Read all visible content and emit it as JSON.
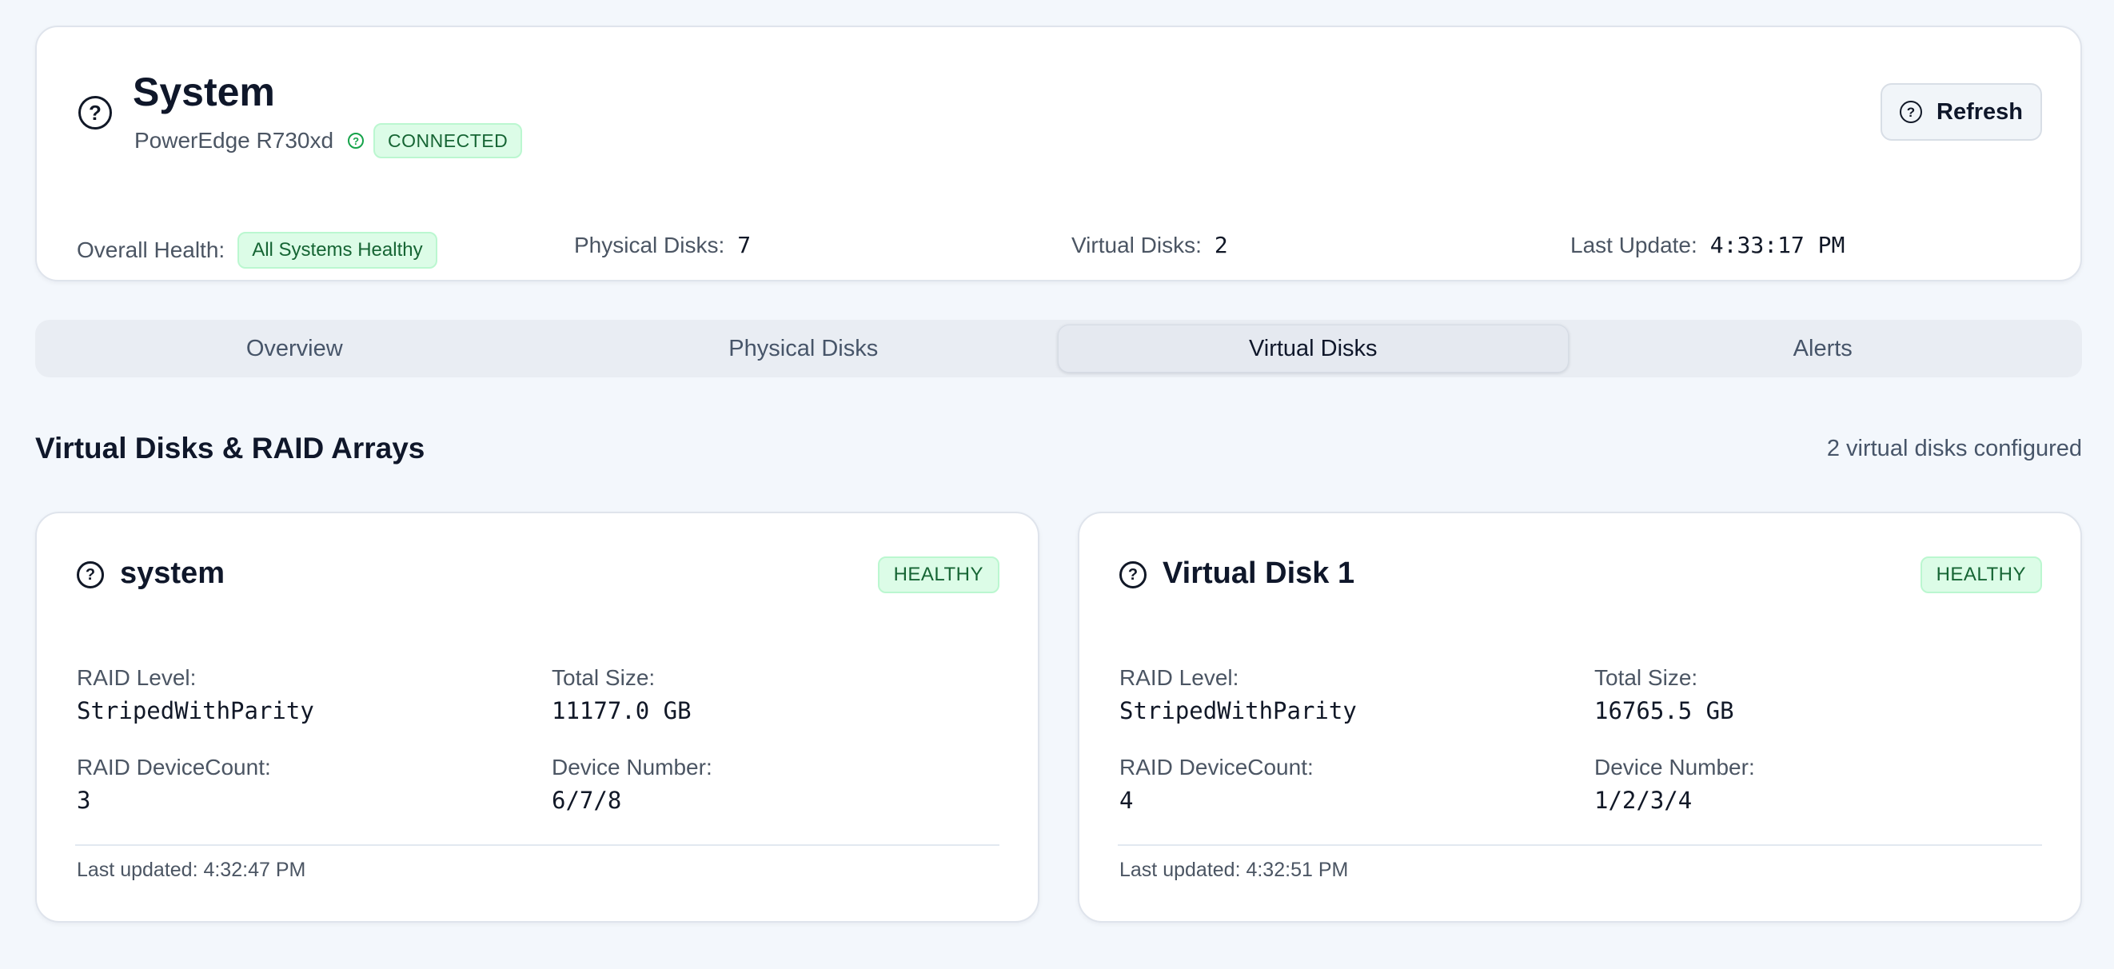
{
  "header": {
    "title": "System",
    "model": "PowerEdge R730xd",
    "connection_status": "CONNECTED",
    "refresh_label": "Refresh",
    "stats": {
      "health_label": "Overall Health:",
      "health_value": "All Systems Healthy",
      "physical_label": "Physical Disks:",
      "physical_value": "7",
      "virtual_label": "Virtual Disks:",
      "virtual_value": "2",
      "update_label": "Last Update:",
      "update_value": "4:33:17 PM"
    }
  },
  "tabs": [
    {
      "label": "Overview",
      "active": false
    },
    {
      "label": "Physical Disks",
      "active": false
    },
    {
      "label": "Virtual Disks",
      "active": true
    },
    {
      "label": "Alerts",
      "active": false
    }
  ],
  "section": {
    "title": "Virtual Disks & RAID Arrays",
    "count_text": "2 virtual disks configured"
  },
  "disks": [
    {
      "name": "system",
      "status": "HEALTHY",
      "raid_level_label": "RAID Level:",
      "raid_level": "StripedWithParity",
      "total_size_label": "Total Size:",
      "total_size": "11177.0 GB",
      "device_count_label": "RAID DeviceCount:",
      "device_count": "3",
      "device_number_label": "Device Number:",
      "device_number": "6/7/8",
      "last_updated": "Last updated: 4:32:47 PM"
    },
    {
      "name": "Virtual Disk 1",
      "status": "HEALTHY",
      "raid_level_label": "RAID Level:",
      "raid_level": "StripedWithParity",
      "total_size_label": "Total Size:",
      "total_size": "16765.5 GB",
      "device_count_label": "RAID DeviceCount:",
      "device_count": "4",
      "device_number_label": "Device Number:",
      "device_number": "1/2/3/4",
      "last_updated": "Last updated: 4:32:51 PM"
    }
  ],
  "icons": {
    "system": "question-circle-icon",
    "connection": "question-circle-icon",
    "refresh": "question-circle-icon",
    "disk": "question-circle-icon"
  },
  "colors": {
    "healthy_bg": "#dcfce7",
    "healthy_text": "#166534",
    "page_bg": "#f3f7fc"
  }
}
